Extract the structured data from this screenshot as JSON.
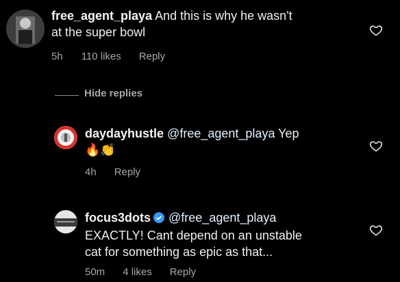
{
  "comments": [
    {
      "username": "free_agent_playa",
      "text_line1": "And this is why he wasn't",
      "text_line2": "at the super bowl",
      "time": "5h",
      "likes": "110 likes",
      "reply": "Reply"
    },
    {
      "username": "daydayhustle",
      "mention": "@free_agent_playa",
      "text": "Yep",
      "emoji": "🔥👏",
      "time": "4h",
      "reply": "Reply"
    },
    {
      "username": "focus3dots",
      "mention": "@free_agent_playa",
      "text_line2": "EXACTLY! Cant depend on an unstable",
      "text_line3": "cat for something as epic as that...",
      "time": "50m",
      "likes": "4 likes",
      "reply": "Reply"
    }
  ],
  "hide_replies": "Hide replies",
  "colors": {
    "background": "#000000",
    "meta": "#a8a8a8",
    "verified": "#3897f0"
  }
}
